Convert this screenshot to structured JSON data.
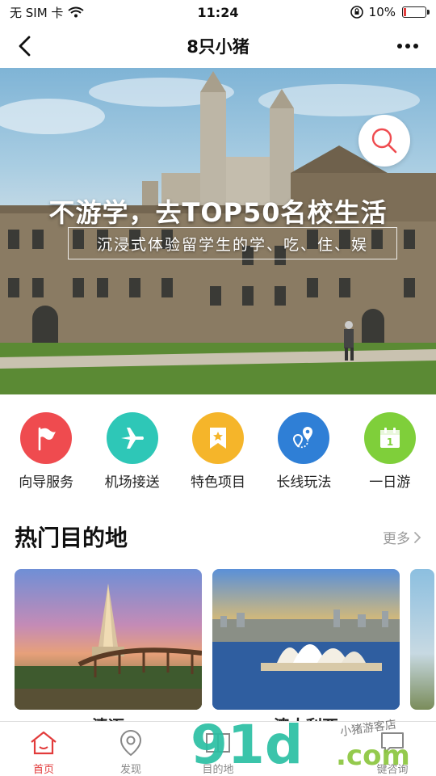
{
  "status_bar": {
    "carrier": "无 SIM 卡",
    "time": "11:24",
    "battery_text": "10%",
    "battery_level": 0.1
  },
  "nav": {
    "title": "8只小猪",
    "back_icon": "chevron-left-icon",
    "more_icon": "more-dots-icon"
  },
  "banner": {
    "headline": "不游学，去TOP50名校生活",
    "subtitle": "沉浸式体验留学生的学、吃、住、娱",
    "search_icon": "search-icon"
  },
  "categories": [
    {
      "label": "向导服务",
      "icon": "flag-icon",
      "color": "#ef4b4f"
    },
    {
      "label": "机场接送",
      "icon": "airplane-icon",
      "color": "#2ec7b7"
    },
    {
      "label": "特色项目",
      "icon": "star-bookmark-icon",
      "color": "#f5b52a"
    },
    {
      "label": "长线玩法",
      "icon": "route-pins-icon",
      "color": "#2f7fd6"
    },
    {
      "label": "一日游",
      "icon": "calendar-icon",
      "color": "#7fcf3a"
    }
  ],
  "section": {
    "title": "热门目的地",
    "more": "更多"
  },
  "destinations": [
    {
      "name": "清迈"
    },
    {
      "name": "澳大利亚"
    }
  ],
  "tabs": [
    {
      "label": "首页",
      "icon": "home-icon",
      "active": true
    },
    {
      "label": "发现",
      "icon": "location-pin-icon",
      "active": false
    },
    {
      "label": "目的地",
      "icon": "map-book-icon",
      "active": false
    },
    {
      "label": "",
      "icon": "",
      "active": false
    },
    {
      "label": "键咨询",
      "icon": "chat-icon",
      "active": false
    }
  ],
  "watermark": {
    "text": "91d.com",
    "script": "小猪游客店"
  },
  "colors": {
    "accent": "#e23b3b",
    "watermark_teal": "#2bbfa3",
    "watermark_green": "#8cc63e"
  }
}
